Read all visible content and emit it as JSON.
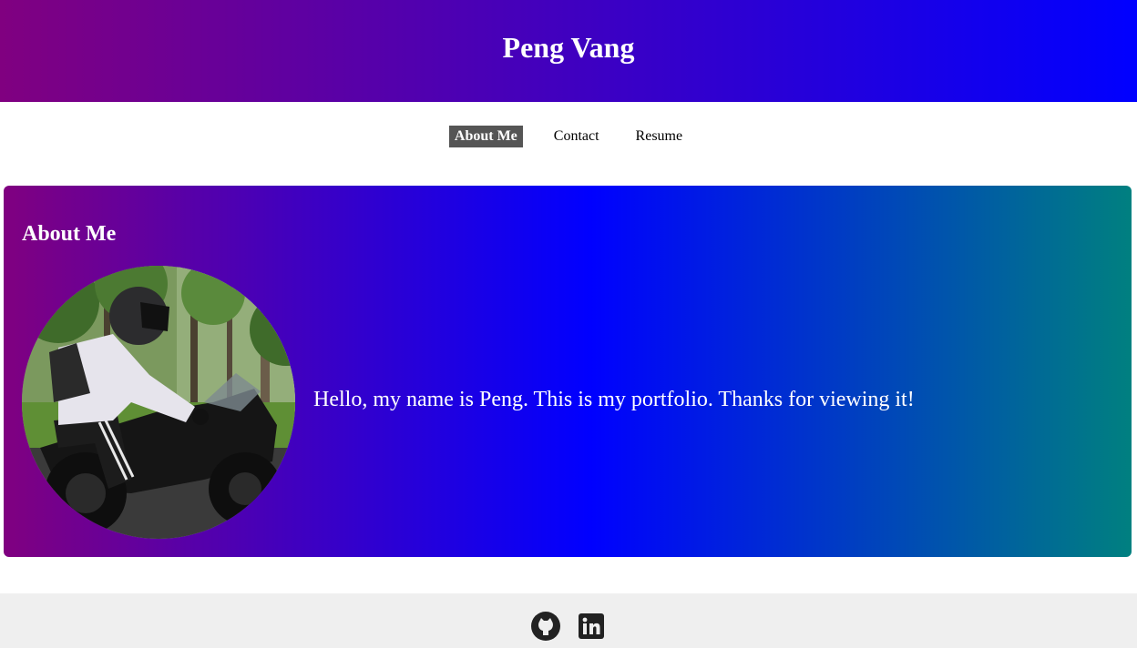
{
  "header": {
    "title": "Peng Vang"
  },
  "nav": {
    "items": [
      {
        "label": "About Me",
        "active": true
      },
      {
        "label": "Contact",
        "active": false
      },
      {
        "label": "Resume",
        "active": false
      }
    ]
  },
  "about": {
    "heading": "About Me",
    "intro": "Hello, my name is Peng. This is my portfolio. Thanks for viewing it!",
    "photo_icon": "profile-photo-motorcycle"
  },
  "footer": {
    "icons": [
      "github-icon",
      "linkedin-icon"
    ]
  },
  "colors": {
    "header_gradient_start": "#800080",
    "header_gradient_end": "#0000ff",
    "card_gradient_start": "#800080",
    "card_gradient_mid": "#0000ff",
    "card_gradient_end": "#008080",
    "active_nav_bg": "#555555",
    "footer_bg": "#efefef"
  }
}
